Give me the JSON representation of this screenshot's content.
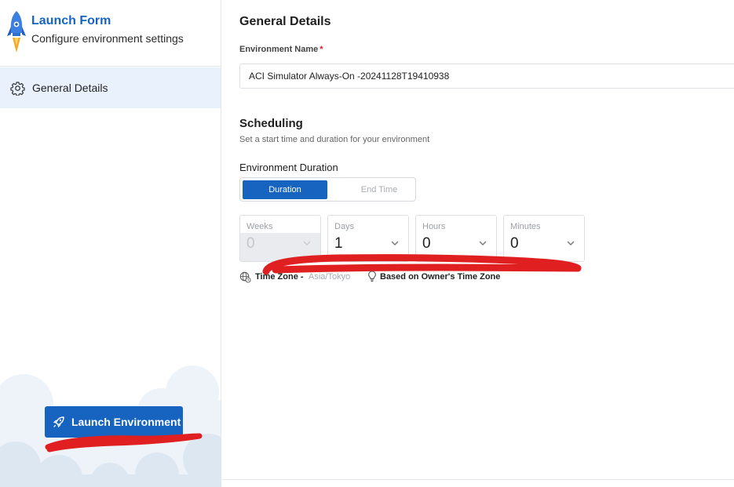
{
  "sidebar": {
    "brand_title": "Launch Form",
    "brand_subtitle": "Configure environment settings",
    "nav_items": [
      {
        "label": "General Details",
        "icon": "gear-icon"
      }
    ],
    "launch_button_label": "Launch Environment"
  },
  "main": {
    "general_heading": "General Details",
    "environment_name_label": "Environment Name",
    "environment_name_required": "*",
    "environment_name_value": "ACI Simulator Always-On -20241128T19410938",
    "scheduling_heading": "Scheduling",
    "scheduling_subtitle": "Set a start time and duration for your environment",
    "duration_label": "Environment Duration",
    "mode_toggle": {
      "options": [
        "Duration",
        "End Time"
      ],
      "selected": "Duration"
    },
    "duration_fields": [
      {
        "label": "Weeks",
        "value": "0",
        "disabled": true
      },
      {
        "label": "Days",
        "value": "1",
        "disabled": false
      },
      {
        "label": "Hours",
        "value": "0",
        "disabled": false
      },
      {
        "label": "Minutes",
        "value": "0",
        "disabled": false
      }
    ],
    "time_zone_label": "Time Zone -",
    "time_zone_value": "Asia/Tokyo",
    "owner_time_zone_note": "Based on Owner's Time Zone"
  },
  "colors": {
    "accent": "#1664c0",
    "nav_active_bg": "#e8f1fc",
    "required": "#d21e2b",
    "annotation": "#e02020"
  }
}
